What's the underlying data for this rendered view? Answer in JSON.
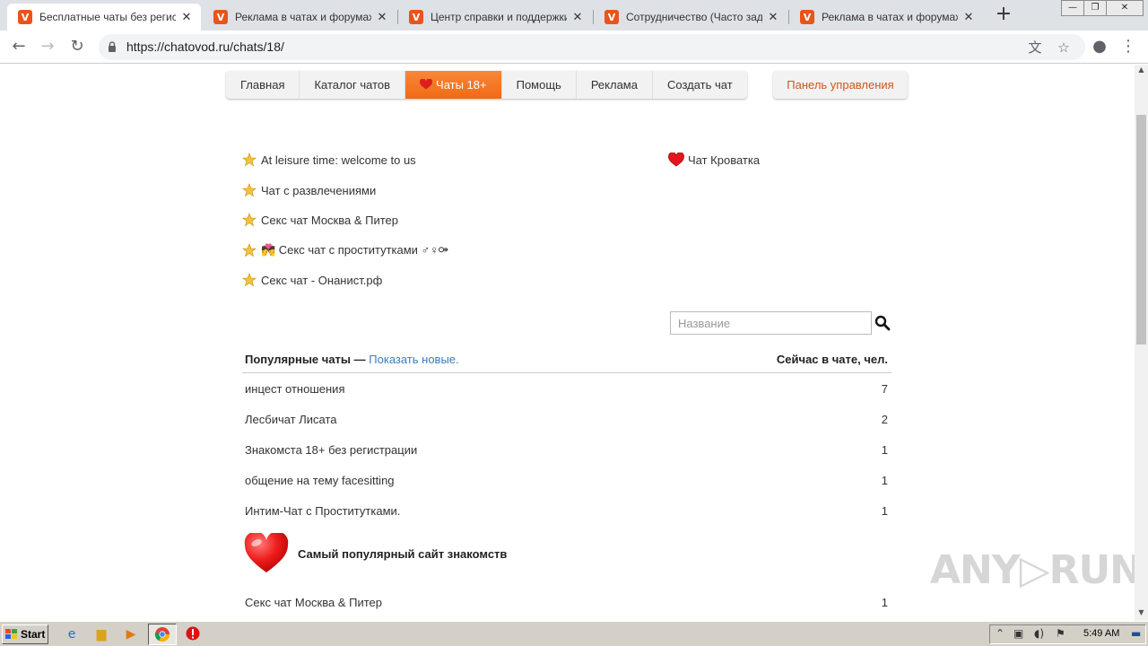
{
  "browser": {
    "tabs": [
      {
        "title": "Бесплатные чаты без регистр",
        "favicon": "V"
      },
      {
        "title": "Реклама в чатах и форумах - С",
        "favicon": "V"
      },
      {
        "title": "Центр справки и поддержки с",
        "favicon": "V"
      },
      {
        "title": "Сотрудничество (Часто задав",
        "favicon": "V"
      },
      {
        "title": "Реклама в чатах и форумах - С",
        "favicon": "V"
      }
    ],
    "url": "https://chatovod.ru/chats/18/"
  },
  "nav": {
    "items": [
      "Главная",
      "Каталог чатов",
      "Чаты 18+",
      "Помощь",
      "Реклама",
      "Создать чат"
    ],
    "active_index": 2,
    "panel": "Панель управления",
    "accent": "#f06a15"
  },
  "featured": {
    "left": [
      "At leisure time: welcome to us",
      "Чат с развлечениями",
      "Секс чат Москва & Питер",
      "💏 Секс чат с проститутками ♂♀⚩",
      "Секс чат - Онанист.рф"
    ],
    "right": [
      "Чат Кроватка"
    ]
  },
  "search": {
    "placeholder": "Название"
  },
  "list": {
    "title": "Популярные чаты",
    "dash": " — ",
    "show_new": "Показать новые.",
    "count_header": "Сейчас в чате, чел.",
    "rows": [
      {
        "name": "инцест отношения",
        "count": "7"
      },
      {
        "name": "Лесбичат Лисата",
        "count": "2"
      },
      {
        "name": "Знакомста 18+ без регистрации",
        "count": "1"
      },
      {
        "name": "общение на тему facesitting",
        "count": "1"
      },
      {
        "name": "Интим-Чат с Проститутками.",
        "count": "1"
      }
    ],
    "promo": "Самый популярный сайт знакомств",
    "rows_after": [
      {
        "name": "Секс чат Москва & Питер",
        "count": "1"
      }
    ]
  },
  "watermark": "ANY▷RUN",
  "taskbar": {
    "start": "Start",
    "clock": "5:49 AM"
  }
}
